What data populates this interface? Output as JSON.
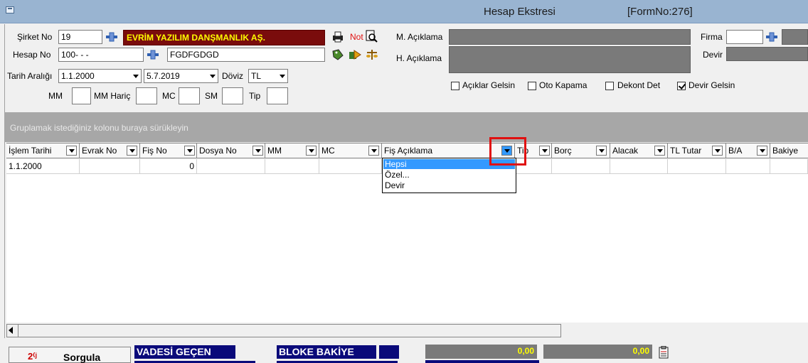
{
  "window": {
    "title": "Hesap Ekstresi",
    "form_no": "[FormNo:276]"
  },
  "header": {
    "sirket_label": "Şirket No",
    "sirket_no": "19",
    "sirket_name": "EVRİM YAZILIM DANŞMANLIK AŞ.",
    "not_label": "Not",
    "hesap_label": "Hesap No",
    "hesap_no": "100- -  -",
    "hesap_name": "FGDFGDGD",
    "tarih_label": "Tarih Aralığı",
    "tarih_from": "1.1.2000",
    "tarih_to": "5.7.2019",
    "doviz_label": "Döviz",
    "doviz": "TL",
    "mm_label": "MM",
    "mm_haric_label": "MM Hariç",
    "mc_label": "MC",
    "sm_label": "SM",
    "tip_label": "Tip",
    "m_aciklama_label": "M. Açıklama",
    "h_aciklama_label": "H. Açıklama",
    "firma_label": "Firma",
    "devir_label": "Devir",
    "checks": [
      {
        "label": "Açıklar Gelsin",
        "checked": false
      },
      {
        "label": "Oto Kapama",
        "checked": false
      },
      {
        "label": "Dekont Det",
        "checked": false
      },
      {
        "label": "Devir Gelsin",
        "checked": true
      }
    ]
  },
  "grid": {
    "group_hint": "Gruplamak istediğiniz kolonu buraya sürükleyin",
    "columns": [
      "İşlem Tarihi",
      "Evrak No",
      "Fiş No",
      "Dosya No",
      "MM",
      "MC",
      "Fiş Açıklama",
      "Tip",
      "Borç",
      "Alacak",
      "TL Tutar",
      "B/A",
      "Bakiye"
    ],
    "rows": [
      {
        "islem_tarihi": "1.1.2000",
        "fis_no": "0"
      }
    ],
    "filter_popup": [
      "Hepsi",
      "Özel...",
      "Devir"
    ]
  },
  "footer": {
    "sorgula": "Sorgula",
    "vadesi_gecen": "VADESİ GEÇEN",
    "bloke_bakiye": "BLOKE BAKİYE",
    "amount1": "0,00",
    "amount2": "0,00"
  },
  "colors": {
    "highlight": "#3399ff",
    "marker": "#e01010",
    "title_bar": "#99b4d1"
  }
}
